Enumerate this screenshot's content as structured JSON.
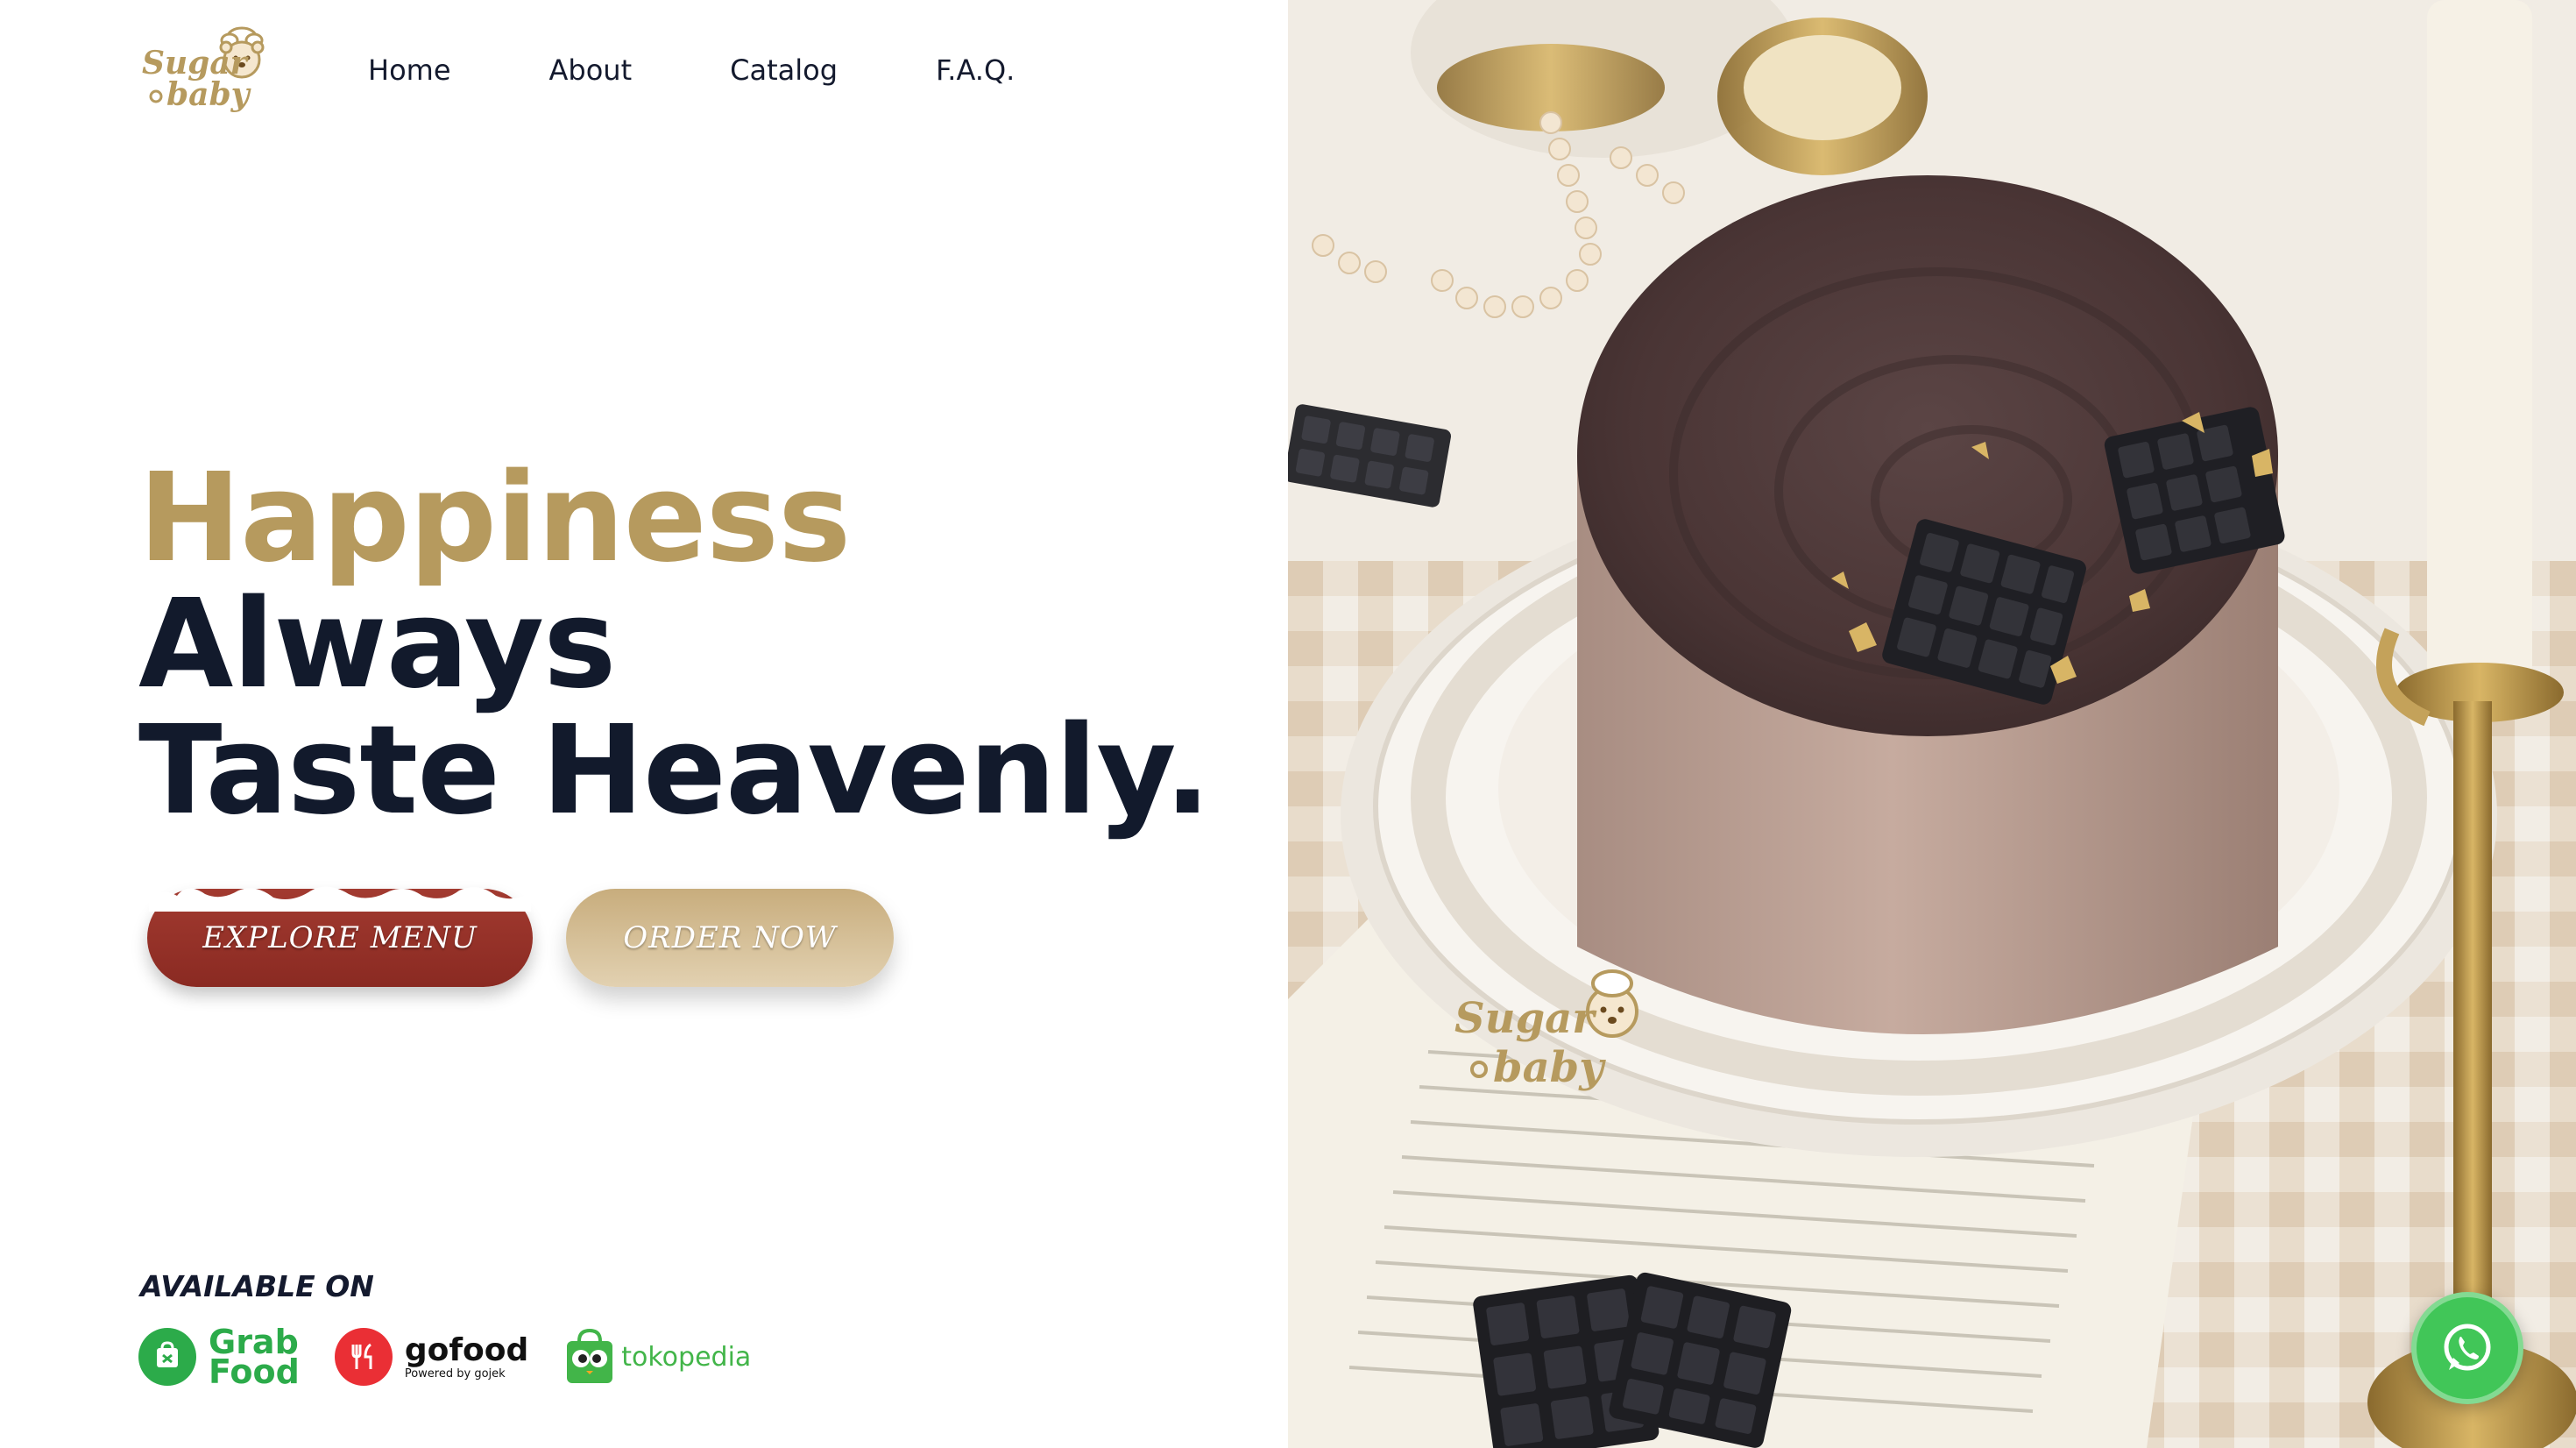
{
  "brand": {
    "logo_line1": "Sugar",
    "logo_line2": "baby",
    "gold": "#b69a5e"
  },
  "nav": {
    "items": [
      {
        "label": "Home"
      },
      {
        "label": "About"
      },
      {
        "label": "Catalog"
      },
      {
        "label": "F.A.Q."
      }
    ]
  },
  "hero": {
    "line1": "Happiness",
    "line2": "Always",
    "line3": "Taste Heavenly."
  },
  "buttons": {
    "explore": "EXPLORE MENU",
    "order": "ORDER NOW"
  },
  "available": {
    "heading": "AVAILABLE ON",
    "partners": [
      {
        "name": "GrabFood",
        "text1": "Grab",
        "text2": "Food",
        "icon": "grabfood-icon",
        "color": "#2cab4a"
      },
      {
        "name": "gofood",
        "text": "gofood",
        "sub": "Powered by gojek",
        "icon": "gofood-icon",
        "color": "#ea2f35"
      },
      {
        "name": "tokopedia",
        "text": "tokopedia",
        "icon": "tokopedia-icon",
        "color": "#42b549"
      }
    ]
  },
  "photo": {
    "watermark_line1": "Sugar",
    "watermark_line2": "baby"
  },
  "whatsapp": {
    "icon": "whatsapp-icon",
    "color": "#41c658"
  }
}
